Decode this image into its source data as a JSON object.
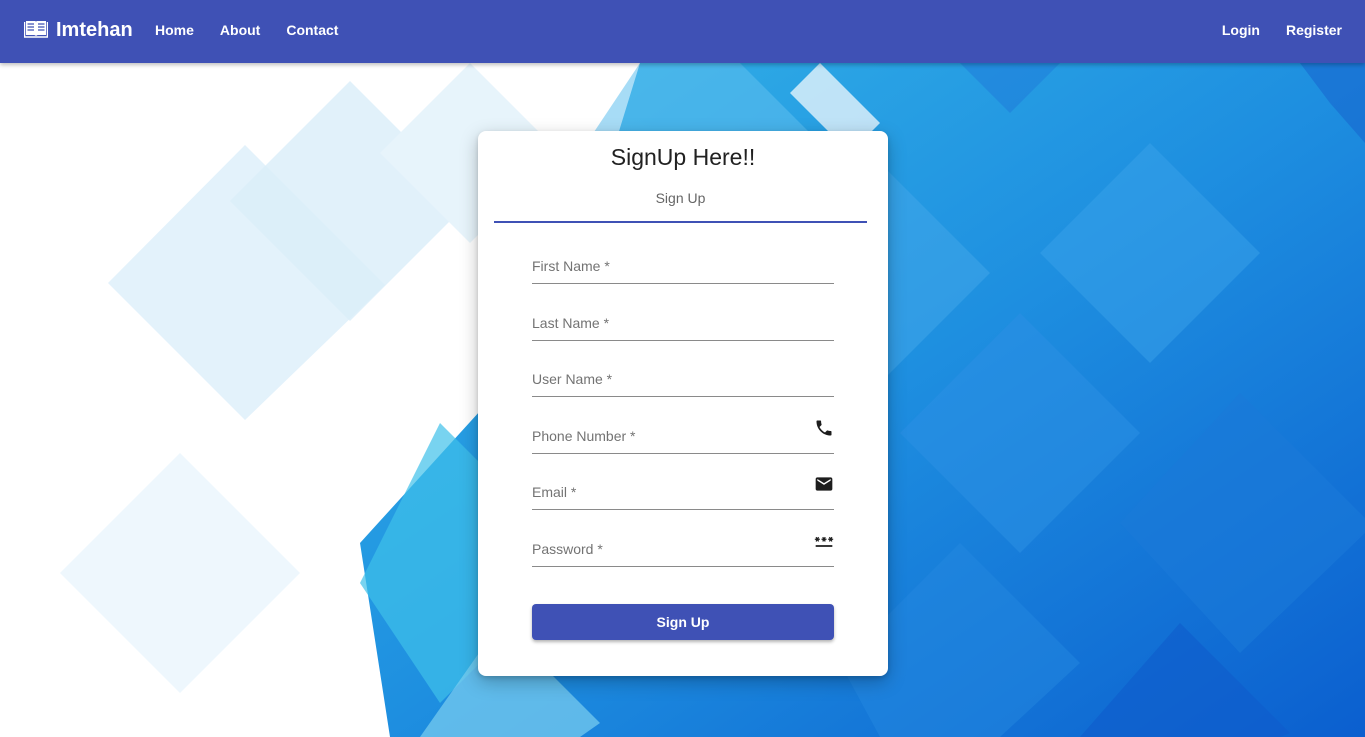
{
  "brand": {
    "name": "Imtehan",
    "icon": "open-book-icon"
  },
  "nav": {
    "left": [
      {
        "label": "Home"
      },
      {
        "label": "About"
      },
      {
        "label": "Contact"
      }
    ],
    "right": [
      {
        "label": "Login"
      },
      {
        "label": "Register"
      }
    ]
  },
  "card": {
    "title": "SignUp Here!!",
    "tab_label": "Sign Up",
    "fields": [
      {
        "label": "First Name *",
        "icon": ""
      },
      {
        "label": "Last Name *",
        "icon": ""
      },
      {
        "label": "User Name *",
        "icon": ""
      },
      {
        "label": "Phone Number *",
        "icon": "phone-icon"
      },
      {
        "label": "Email *",
        "icon": "email-icon"
      },
      {
        "label": "Password *",
        "icon": "password-icon"
      }
    ],
    "submit_label": "Sign Up"
  },
  "colors": {
    "primary": "#3f51b5",
    "background_blue": "#1e88e5",
    "text_muted": "#737373"
  }
}
